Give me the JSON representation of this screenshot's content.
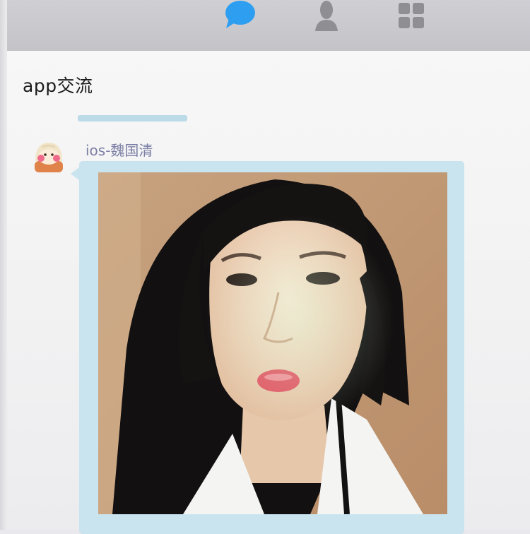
{
  "nav": {
    "tabs": [
      {
        "icon": "chat-bubble-icon",
        "active": true,
        "color": "#2d9ef0"
      },
      {
        "icon": "person-icon",
        "active": false,
        "color": "#8e8e93"
      },
      {
        "icon": "apps-grid-icon",
        "active": false,
        "color": "#8e8e93"
      }
    ]
  },
  "page": {
    "title": "app交流"
  },
  "message": {
    "sender": "ios-魏国清",
    "avatar_icon": "cartoon-avatar-icon",
    "content_type": "image",
    "bubble_color": "#c9e4ee"
  }
}
